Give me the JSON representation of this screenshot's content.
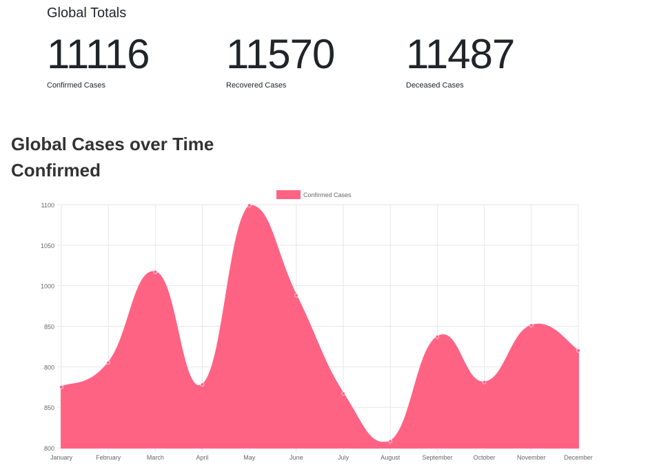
{
  "totals": {
    "title": "Global Totals",
    "confirmed": {
      "value": "11116",
      "label": "Confirmed Cases"
    },
    "recovered": {
      "value": "11570",
      "label": "Recovered Cases"
    },
    "deceased": {
      "value": "11487",
      "label": "Deceased Cases"
    }
  },
  "section": {
    "title": "Global Cases over Time",
    "subtitle": "Confirmed"
  },
  "chart_data": {
    "type": "area",
    "categories": [
      "January",
      "February",
      "March",
      "April",
      "May",
      "June",
      "July",
      "August",
      "September",
      "October",
      "November",
      "December"
    ],
    "series": [
      {
        "name": "Confirmed Cases",
        "color": "#ff6384",
        "values": [
          875,
          905,
          1017,
          878,
          1099,
          988,
          867,
          808,
          937,
          881,
          951,
          920
        ]
      }
    ],
    "ylim": [
      800,
      1100
    ],
    "yticks": [
      800,
      850,
      900,
      950,
      1000,
      1050,
      1100
    ],
    "ytick_labels": [
      "800",
      "850",
      "800",
      "850",
      "1000",
      "1050",
      "1100"
    ],
    "grid": true,
    "legend": "top-center"
  }
}
